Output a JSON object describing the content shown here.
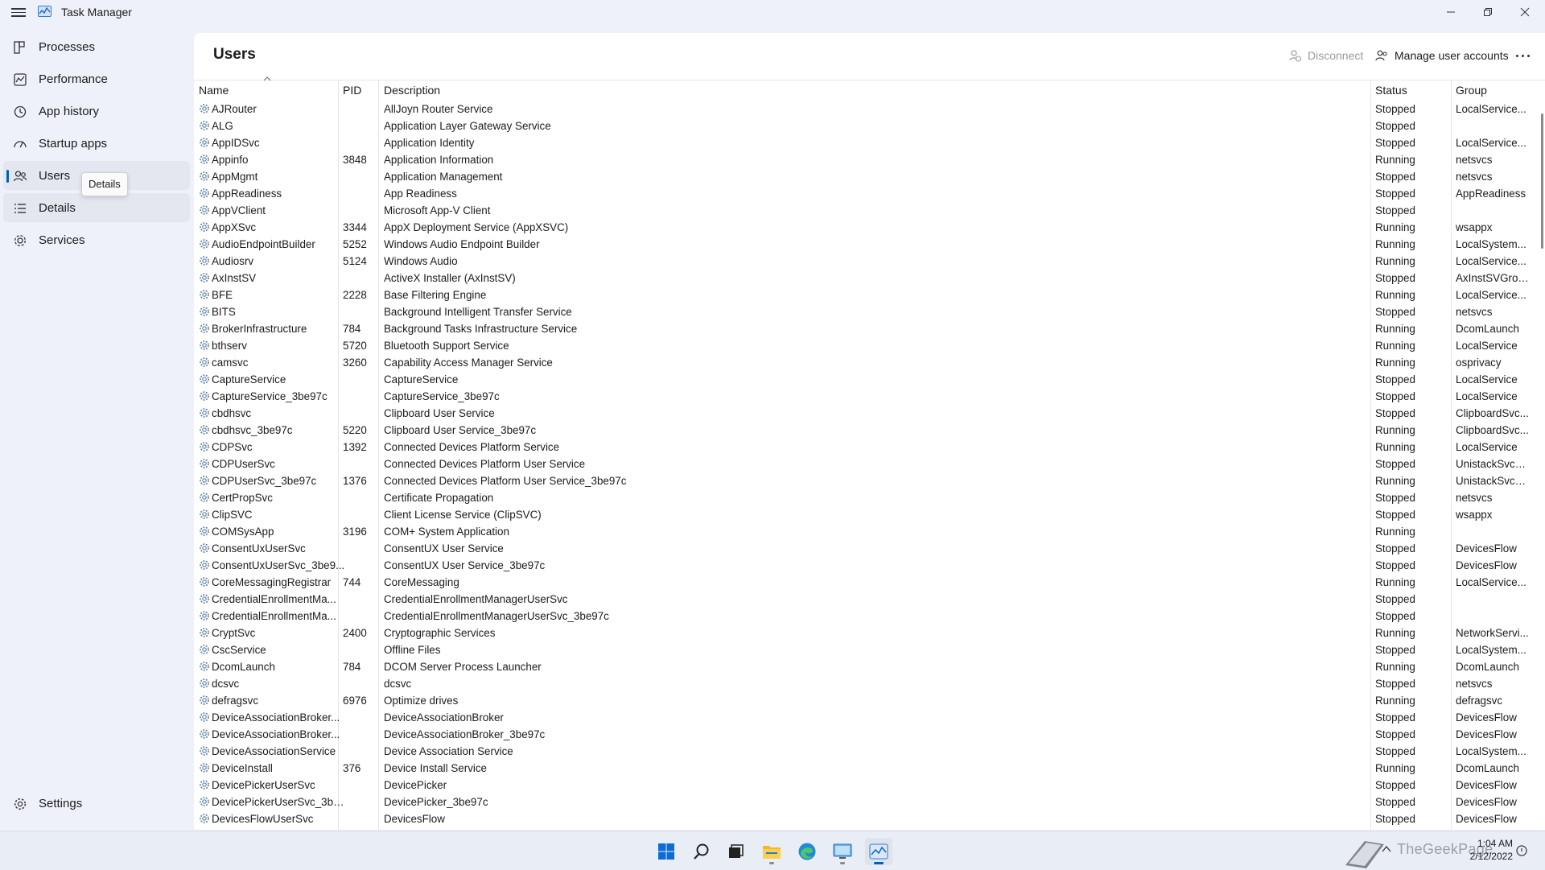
{
  "window": {
    "title": "Task Manager"
  },
  "sidebar": {
    "items": [
      {
        "label": "Processes"
      },
      {
        "label": "Performance"
      },
      {
        "label": "App history"
      },
      {
        "label": "Startup apps"
      },
      {
        "label": "Users"
      },
      {
        "label": "Details"
      },
      {
        "label": "Services"
      }
    ],
    "settings_label": "Settings",
    "tooltip": "Details"
  },
  "main": {
    "title": "Users",
    "disconnect_label": "Disconnect",
    "manage_label": "Manage user accounts"
  },
  "table": {
    "columns": [
      "Name",
      "PID",
      "Description",
      "Status",
      "Group"
    ],
    "rows": [
      [
        "AJRouter",
        "",
        "AllJoyn Router Service",
        "Stopped",
        "LocalService..."
      ],
      [
        "ALG",
        "",
        "Application Layer Gateway Service",
        "Stopped",
        ""
      ],
      [
        "AppIDSvc",
        "",
        "Application Identity",
        "Stopped",
        "LocalService..."
      ],
      [
        "Appinfo",
        "3848",
        "Application Information",
        "Running",
        "netsvcs"
      ],
      [
        "AppMgmt",
        "",
        "Application Management",
        "Stopped",
        "netsvcs"
      ],
      [
        "AppReadiness",
        "",
        "App Readiness",
        "Stopped",
        "AppReadiness"
      ],
      [
        "AppVClient",
        "",
        "Microsoft App-V Client",
        "Stopped",
        ""
      ],
      [
        "AppXSvc",
        "3344",
        "AppX Deployment Service (AppXSVC)",
        "Running",
        "wsappx"
      ],
      [
        "AudioEndpointBuilder",
        "5252",
        "Windows Audio Endpoint Builder",
        "Running",
        "LocalSystem..."
      ],
      [
        "Audiosrv",
        "5124",
        "Windows Audio",
        "Running",
        "LocalService..."
      ],
      [
        "AxInstSV",
        "",
        "ActiveX Installer (AxInstSV)",
        "Stopped",
        "AxInstSVGroup"
      ],
      [
        "BFE",
        "2228",
        "Base Filtering Engine",
        "Running",
        "LocalService..."
      ],
      [
        "BITS",
        "",
        "Background Intelligent Transfer Service",
        "Stopped",
        "netsvcs"
      ],
      [
        "BrokerInfrastructure",
        "784",
        "Background Tasks Infrastructure Service",
        "Running",
        "DcomLaunch"
      ],
      [
        "bthserv",
        "5720",
        "Bluetooth Support Service",
        "Running",
        "LocalService"
      ],
      [
        "camsvc",
        "3260",
        "Capability Access Manager Service",
        "Running",
        "osprivacy"
      ],
      [
        "CaptureService",
        "",
        "CaptureService",
        "Stopped",
        "LocalService"
      ],
      [
        "CaptureService_3be97c",
        "",
        "CaptureService_3be97c",
        "Stopped",
        "LocalService"
      ],
      [
        "cbdhsvc",
        "",
        "Clipboard User Service",
        "Stopped",
        "ClipboardSvc..."
      ],
      [
        "cbdhsvc_3be97c",
        "5220",
        "Clipboard User Service_3be97c",
        "Running",
        "ClipboardSvc..."
      ],
      [
        "CDPSvc",
        "1392",
        "Connected Devices Platform Service",
        "Running",
        "LocalService"
      ],
      [
        "CDPUserSvc",
        "",
        "Connected Devices Platform User Service",
        "Stopped",
        "UnistackSvcG..."
      ],
      [
        "CDPUserSvc_3be97c",
        "1376",
        "Connected Devices Platform User Service_3be97c",
        "Running",
        "UnistackSvcG..."
      ],
      [
        "CertPropSvc",
        "",
        "Certificate Propagation",
        "Stopped",
        "netsvcs"
      ],
      [
        "ClipSVC",
        "",
        "Client License Service (ClipSVC)",
        "Stopped",
        "wsappx"
      ],
      [
        "COMSysApp",
        "3196",
        "COM+ System Application",
        "Running",
        ""
      ],
      [
        "ConsentUxUserSvc",
        "",
        "ConsentUX User Service",
        "Stopped",
        "DevicesFlow"
      ],
      [
        "ConsentUxUserSvc_3be9...",
        "",
        "ConsentUX User Service_3be97c",
        "Stopped",
        "DevicesFlow"
      ],
      [
        "CoreMessagingRegistrar",
        "744",
        "CoreMessaging",
        "Running",
        "LocalService..."
      ],
      [
        "CredentialEnrollmentMa...",
        "",
        "CredentialEnrollmentManagerUserSvc",
        "Stopped",
        ""
      ],
      [
        "CredentialEnrollmentMa...",
        "",
        "CredentialEnrollmentManagerUserSvc_3be97c",
        "Stopped",
        ""
      ],
      [
        "CryptSvc",
        "2400",
        "Cryptographic Services",
        "Running",
        "NetworkServi..."
      ],
      [
        "CscService",
        "",
        "Offline Files",
        "Stopped",
        "LocalSystem..."
      ],
      [
        "DcomLaunch",
        "784",
        "DCOM Server Process Launcher",
        "Running",
        "DcomLaunch"
      ],
      [
        "dcsvc",
        "",
        "dcsvc",
        "Stopped",
        "netsvcs"
      ],
      [
        "defragsvc",
        "6976",
        "Optimize drives",
        "Running",
        "defragsvc"
      ],
      [
        "DeviceAssociationBroker...",
        "",
        "DeviceAssociationBroker",
        "Stopped",
        "DevicesFlow"
      ],
      [
        "DeviceAssociationBroker...",
        "",
        "DeviceAssociationBroker_3be97c",
        "Stopped",
        "DevicesFlow"
      ],
      [
        "DeviceAssociationService",
        "",
        "Device Association Service",
        "Stopped",
        "LocalSystem..."
      ],
      [
        "DeviceInstall",
        "376",
        "Device Install Service",
        "Running",
        "DcomLaunch"
      ],
      [
        "DevicePickerUserSvc",
        "",
        "DevicePicker",
        "Stopped",
        "DevicesFlow"
      ],
      [
        "DevicePickerUserSvc_3be...",
        "",
        "DevicePicker_3be97c",
        "Stopped",
        "DevicesFlow"
      ],
      [
        "DevicesFlowUserSvc",
        "",
        "DevicesFlow",
        "Stopped",
        "DevicesFlow"
      ]
    ]
  },
  "taskbar": {
    "time": "1:04 AM",
    "date": "2/12/2022",
    "watermark": "TheGeekPage"
  },
  "colors": {
    "accent": "#005fb8",
    "sidebar_bg": "#eef1f9",
    "panel_bg": "#ffffff"
  }
}
